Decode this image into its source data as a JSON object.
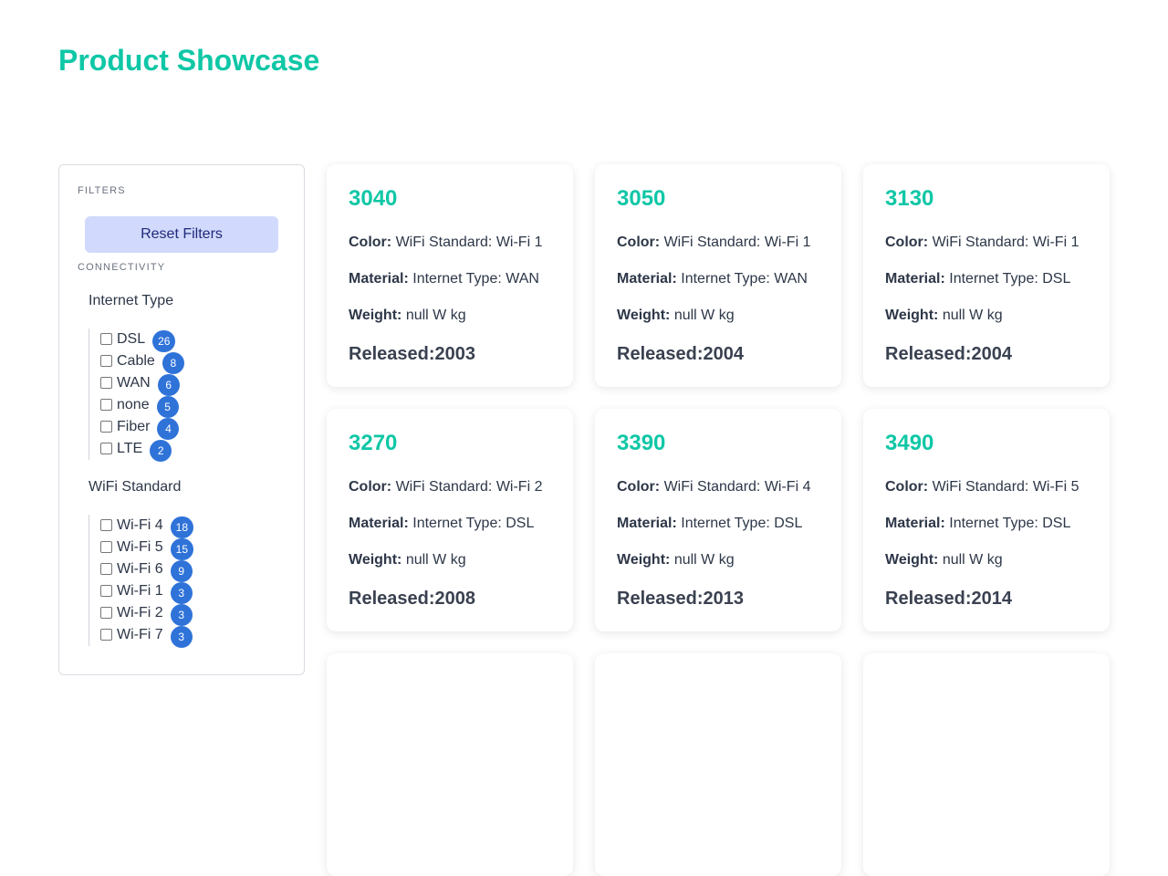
{
  "page": {
    "title": "Product Showcase"
  },
  "sidebar": {
    "filters_label": "FILTERS",
    "reset_label": "Reset Filters",
    "connectivity_label": "CONNECTIVITY",
    "internet_type": {
      "title": "Internet Type",
      "options": [
        {
          "label": "DSL",
          "count": "26"
        },
        {
          "label": "Cable",
          "count": "8"
        },
        {
          "label": "WAN",
          "count": "6"
        },
        {
          "label": "none",
          "count": "5"
        },
        {
          "label": "Fiber",
          "count": "4"
        },
        {
          "label": "LTE",
          "count": "2"
        }
      ]
    },
    "wifi_standard": {
      "title": "WiFi Standard",
      "options": [
        {
          "label": "Wi-Fi 4",
          "count": "18"
        },
        {
          "label": "Wi-Fi 5",
          "count": "15"
        },
        {
          "label": "Wi-Fi 6",
          "count": "9"
        },
        {
          "label": "Wi-Fi 1",
          "count": "3"
        },
        {
          "label": "Wi-Fi 2",
          "count": "3"
        },
        {
          "label": "Wi-Fi 7",
          "count": "3"
        }
      ]
    }
  },
  "labels": {
    "color": "Color:",
    "material": "Material:",
    "weight": "Weight:"
  },
  "products": [
    {
      "name": "3040",
      "color": "WiFi Standard: Wi-Fi 1",
      "material": "Internet Type: WAN",
      "weight": "null W kg",
      "released": "Released:2003"
    },
    {
      "name": "3050",
      "color": "WiFi Standard: Wi-Fi 1",
      "material": "Internet Type: WAN",
      "weight": "null W kg",
      "released": "Released:2004"
    },
    {
      "name": "3130",
      "color": "WiFi Standard: Wi-Fi 1",
      "material": "Internet Type: DSL",
      "weight": "null W kg",
      "released": "Released:2004"
    },
    {
      "name": "3270",
      "color": "WiFi Standard: Wi-Fi 2",
      "material": "Internet Type: DSL",
      "weight": "null W kg",
      "released": "Released:2008"
    },
    {
      "name": "3390",
      "color": "WiFi Standard: Wi-Fi 4",
      "material": "Internet Type: DSL",
      "weight": "null W kg",
      "released": "Released:2013"
    },
    {
      "name": "3490",
      "color": "WiFi Standard: Wi-Fi 5",
      "material": "Internet Type: DSL",
      "weight": "null W kg",
      "released": "Released:2014"
    }
  ]
}
